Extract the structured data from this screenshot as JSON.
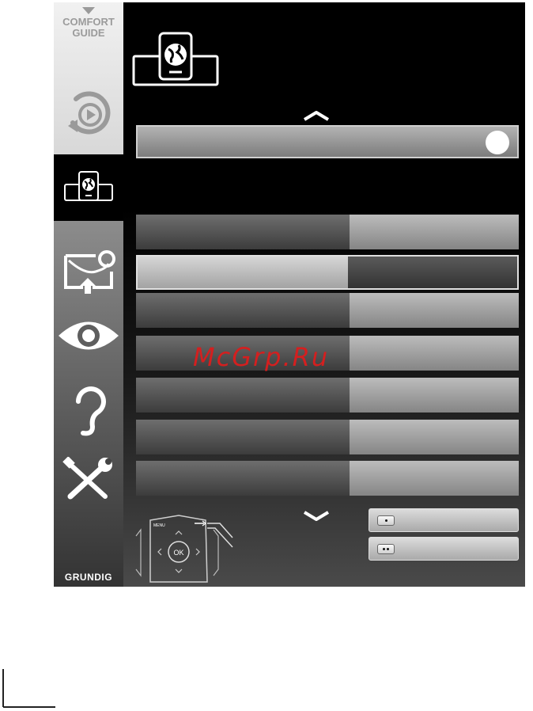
{
  "sidebar": {
    "title_line1": "COMFORT",
    "title_line2": "GUIDE",
    "brand": "GRUNDIG",
    "items": [
      {
        "icon": "media-play-icon",
        "active": false
      },
      {
        "icon": "network-globe-icon",
        "active": true
      },
      {
        "icon": "source-input-icon",
        "active": false
      },
      {
        "icon": "picture-eye-icon",
        "active": false
      },
      {
        "icon": "sound-ear-icon",
        "active": false
      },
      {
        "icon": "settings-tools-icon",
        "active": false
      }
    ]
  },
  "header": {
    "icon": "network-globe-icon"
  },
  "dropdown": {
    "label": "",
    "knob": "toggle-circle"
  },
  "rows": [
    {
      "label": "",
      "value": "",
      "selected": false
    },
    {
      "label": "",
      "value": "",
      "selected": true
    },
    {
      "label": "",
      "value": "",
      "selected": false
    },
    {
      "label": "",
      "value": "",
      "selected": false
    },
    {
      "label": "",
      "value": "",
      "selected": false
    },
    {
      "label": "",
      "value": "",
      "selected": false
    },
    {
      "label": "",
      "value": "",
      "selected": false
    }
  ],
  "buttons": [
    {
      "key_dots": 1,
      "label": ""
    },
    {
      "key_dots": 2,
      "label": ""
    }
  ],
  "remote": {
    "ok_label": "OK",
    "menu_label": "MENU"
  },
  "watermark": "McGrp.Ru",
  "colors": {
    "watermark": "#d41f1f",
    "panel": "#000000"
  }
}
